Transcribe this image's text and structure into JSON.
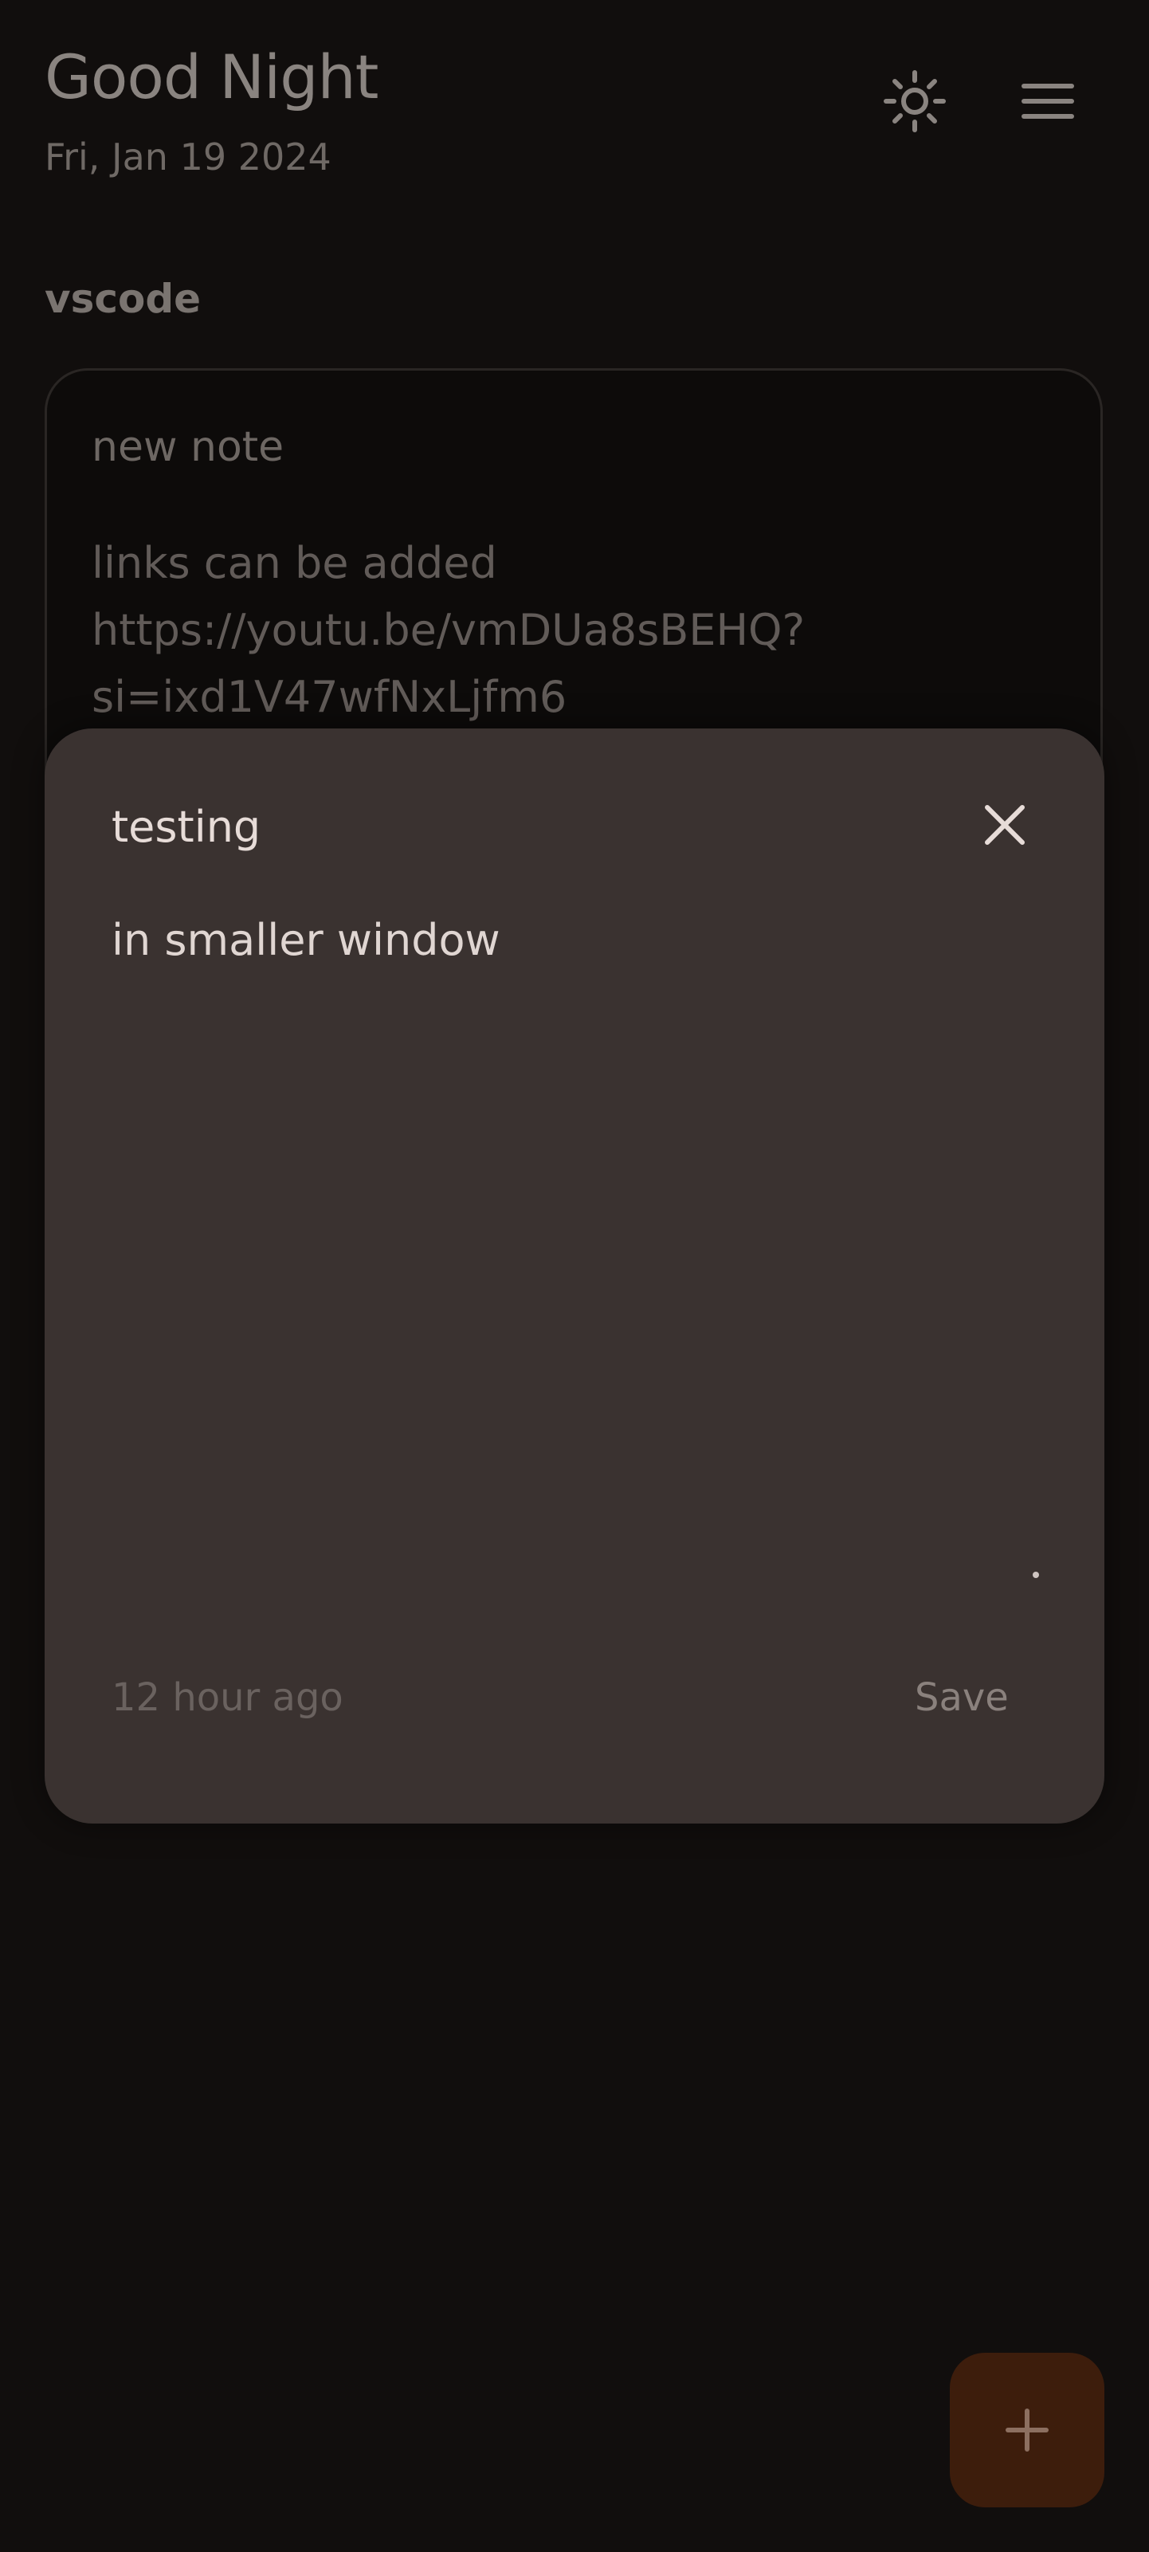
{
  "header": {
    "greeting": "Good Night",
    "date": "Fri, Jan 19 2024",
    "theme_icon": "sun-icon",
    "menu_icon": "hamburger-menu-icon"
  },
  "section": {
    "title": "vscode"
  },
  "note_card": {
    "title": "new note",
    "body": "links can be added\nhttps://youtu.be/vmDUa8sBEHQ?\nsi=ixd1V47wfNxLjfm6"
  },
  "modal": {
    "title": "testing",
    "body": "in smaller window",
    "timestamp": "12 hour ago",
    "save_label": "Save",
    "close_icon": "close-icon"
  },
  "fab": {
    "icon": "plus-icon"
  },
  "colors": {
    "background": "#110e0d",
    "modal": "#3a3230",
    "fab": "#3d1d0c",
    "fab_icon": "#8c6f60"
  }
}
